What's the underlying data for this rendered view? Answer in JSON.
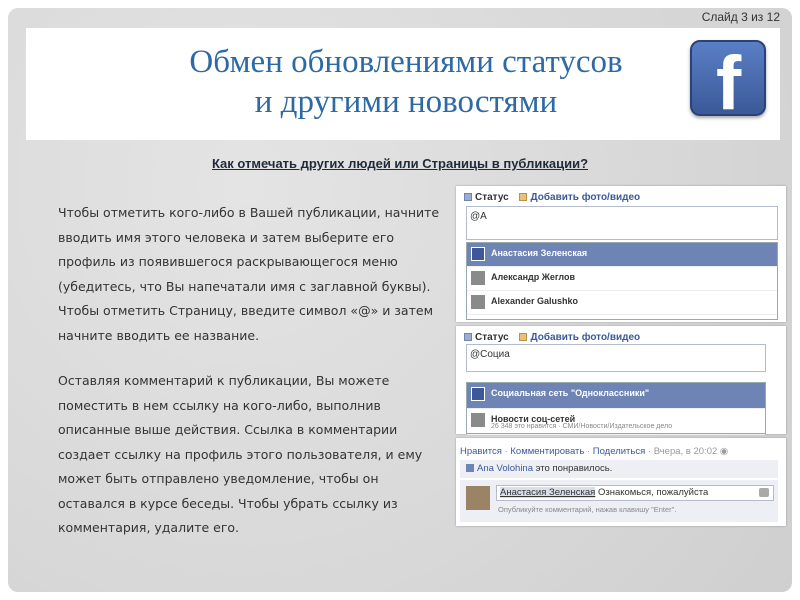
{
  "slide": {
    "counter": "Слайд 3 из 12",
    "title_line1": "Обмен обновлениями статусов",
    "title_line2": "и другими новостями",
    "subheading": "Как отмечать других людей или Страницы в публикации?",
    "paragraph1": "Чтобы отметить кого-либо в Вашей публикации, начните вводить имя этого человека и затем выберите его профиль из появившегося раскрывающегося меню (убедитесь, что Вы напечатали имя с заглавной буквы). Чтобы отметить Страницу, введите символ «@» и затем начните вводить ее название.",
    "paragraph2": "Оставляя комментарий к публикации, Вы можете поместить в нем ссылку на кого-либо, выполнив описанные выше действия. Ссылка в комментарии создает ссылку на профиль этого пользователя, и ему может быть отправлено уведомление, чтобы он оставался в курсе беседы. Чтобы убрать ссылку из комментария, удалите его."
  },
  "logo": {
    "letter": "f",
    "icon": "facebook-logo-icon",
    "color": "#3b5998"
  },
  "shot1": {
    "tab_status": "Статус",
    "tab_photo": "Добавить фото/видео",
    "input_value": "@А",
    "options": [
      "Анастасия Зеленская",
      "Александр Жеглов",
      "Alexander Galushko"
    ]
  },
  "shot2": {
    "tab_status": "Статус",
    "tab_photo": "Добавить фото/видео",
    "input_value": "@Социа",
    "options": [
      {
        "name": "Социальная сеть \"Одноклассники\"",
        "sub": ""
      },
      {
        "name": "Новости соц-сетей",
        "sub": "26 348 это нравится · СМИ/Новости/Издательское дело"
      }
    ]
  },
  "shot3": {
    "like": "Нравится",
    "comment": "Комментировать",
    "share": "Поделиться",
    "time": "Вчера, в 20:02",
    "liker": "Ana Volohina",
    "liked_text": "это понравилось.",
    "tagged_name": "Анастасия Зеленская",
    "comment_text": " Ознакомься, пожалуйста",
    "hint": "Опубликуйте комментарий, нажав клавишу \"Enter\"."
  },
  "colors": {
    "title": "#2d6aa5",
    "brand": "#3b5998",
    "selected_row": "#6d84b4"
  }
}
